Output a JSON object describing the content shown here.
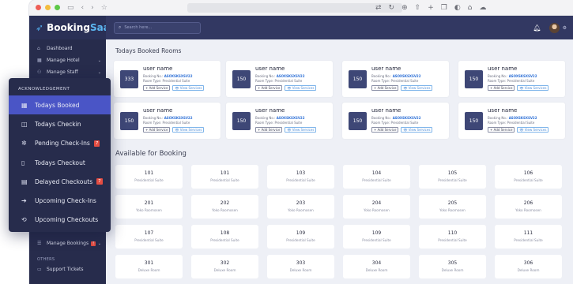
{
  "app": {
    "brand_main": "Booking",
    "brand_accent": "SaaS"
  },
  "colors": {
    "sidebar": "#272c4c",
    "topbar": "#323862",
    "active": "#4a55c6",
    "link": "#2c6fd6",
    "badge": "#e54d42"
  },
  "topbar": {
    "search_placeholder": "Search here..."
  },
  "sidebar": {
    "items": [
      {
        "label": "Dashboard",
        "icon": "home-icon"
      },
      {
        "label": "Manage Hotel",
        "icon": "building-icon"
      },
      {
        "label": "Manage Staff",
        "icon": "users-icon"
      }
    ],
    "bottom_items": [
      {
        "label": "Manage Bookings",
        "badge": "!"
      }
    ],
    "others_title": "OTHERS",
    "support_label": "Support Tickets"
  },
  "popup": {
    "title": "ACKNOWLEDGEMENT",
    "items": [
      {
        "label": "Todays Booked",
        "icon": "calendar-check-icon",
        "active": true
      },
      {
        "label": "Todays Checkin",
        "icon": "door-in-icon"
      },
      {
        "label": "Pending Check-Ins",
        "icon": "spinner-icon",
        "badge": "7"
      },
      {
        "label": "Todays Checkout",
        "icon": "door-out-icon"
      },
      {
        "label": "Delayed Checkouts",
        "icon": "calendar-x-icon",
        "badge": "7"
      },
      {
        "label": "Upcoming Check-Ins",
        "icon": "arrow-right-circle-icon"
      },
      {
        "label": "Upcoming Checkouts",
        "icon": "arrow-left-circle-icon"
      }
    ]
  },
  "booked": {
    "title": "Todays Booked Rooms",
    "booking_label": "Booking No.:",
    "room_type_label": "Room Type:",
    "add_label": "+ Add Service",
    "view_label": "👁 View Services",
    "cards": [
      {
        "room": "333",
        "name": "user name",
        "booking": "ASOXSKSXSV22",
        "type": "Presidential Suite"
      },
      {
        "room": "150",
        "name": "user name",
        "booking": "ASOXSKSXSV22",
        "type": "Presidential Suite"
      },
      {
        "room": "150",
        "name": "user name",
        "booking": "ASOXSKSXSV22",
        "type": "Presidential Suite"
      },
      {
        "room": "150",
        "name": "user name",
        "booking": "ASOXSKSXSV22",
        "type": "Presidential Suite"
      },
      {
        "room": "150",
        "name": "user name",
        "booking": "ASOXSKSXSV22",
        "type": "Presidential Suite"
      },
      {
        "room": "150",
        "name": "user name",
        "booking": "ASOXSKSXSV22",
        "type": "Presidential Suite"
      },
      {
        "room": "150",
        "name": "user name",
        "booking": "ASOXSKSXSV22",
        "type": "Presidential Suite"
      },
      {
        "room": "150",
        "name": "user name",
        "booking": "ASOXSKSXSV22",
        "type": "Presidential Suite"
      }
    ]
  },
  "available": {
    "title": "Available for Booking",
    "rooms": [
      {
        "num": "101",
        "type": "Presidential Suite"
      },
      {
        "num": "101",
        "type": "Presidential Suite"
      },
      {
        "num": "103",
        "type": "Presidential Suite"
      },
      {
        "num": "104",
        "type": "Presidential Suite"
      },
      {
        "num": "105",
        "type": "Presidential Suite"
      },
      {
        "num": "106",
        "type": "Presidential Suite"
      },
      {
        "num": "201",
        "type": "Yoko Roomosen"
      },
      {
        "num": "202",
        "type": "Yoko Roomosen"
      },
      {
        "num": "203",
        "type": "Yoko Roomosen"
      },
      {
        "num": "204",
        "type": "Yoko Roomosen"
      },
      {
        "num": "205",
        "type": "Yoko Roomosen"
      },
      {
        "num": "206",
        "type": "Yoko Roomosen"
      },
      {
        "num": "107",
        "type": "Presidential Suite"
      },
      {
        "num": "108",
        "type": "Presidential Suite"
      },
      {
        "num": "109",
        "type": "Presidential Suite"
      },
      {
        "num": "109",
        "type": "Presidential Suite"
      },
      {
        "num": "110",
        "type": "Presidential Suite"
      },
      {
        "num": "111",
        "type": "Presidential Suite"
      },
      {
        "num": "301",
        "type": "Deluxe Room"
      },
      {
        "num": "302",
        "type": "Deluxe Room"
      },
      {
        "num": "303",
        "type": "Deluxe Room"
      },
      {
        "num": "304",
        "type": "Deluxe Room"
      },
      {
        "num": "305",
        "type": "Deluxe Room"
      },
      {
        "num": "306",
        "type": "Deluxe Room"
      }
    ]
  }
}
